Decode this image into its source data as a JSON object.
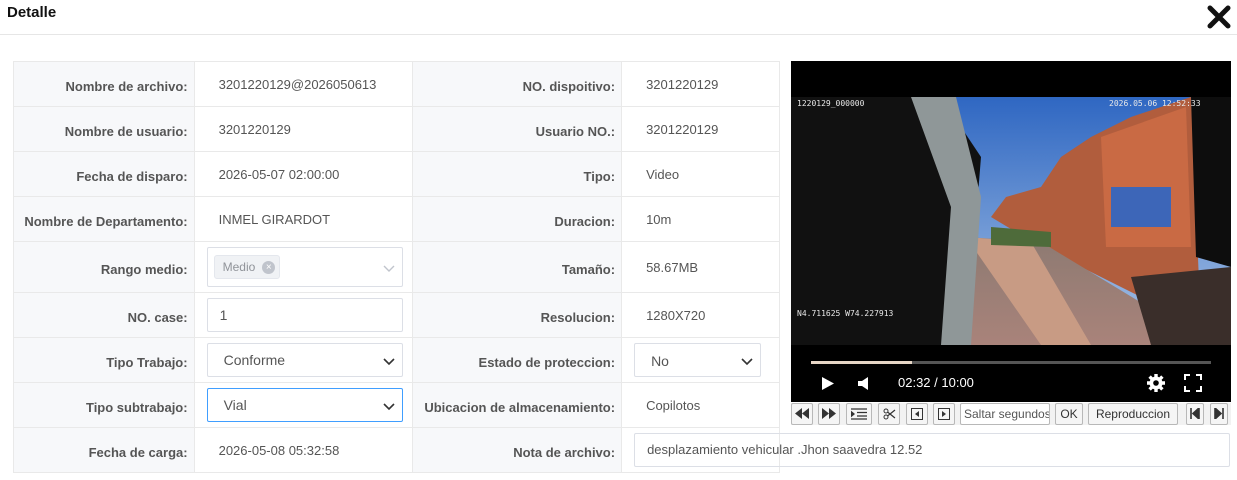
{
  "dialog": {
    "title": "Detalle"
  },
  "left": [
    {
      "label": "Nombre de archivo:",
      "value": "3201220129@2026050613"
    },
    {
      "label": "Nombre de usuario:",
      "value": "3201220129"
    },
    {
      "label": "Fecha de disparo:",
      "value": "2026-05-07 02:00:00"
    },
    {
      "label": "Nombre de Departamento:",
      "value": "INMEL GIRARDOT"
    },
    {
      "label": "Rango medio:",
      "tag": "Medio"
    },
    {
      "label": "NO. case:",
      "value": "1"
    },
    {
      "label": "Tipo Trabajo:",
      "value": "Conforme"
    },
    {
      "label": "Tipo subtrabajo:",
      "value": "Vial"
    },
    {
      "label": "Fecha de carga:",
      "value": "2026-05-08 05:32:58"
    }
  ],
  "right": [
    {
      "label": "NO. dispoitivo:",
      "value": "3201220129"
    },
    {
      "label": "Usuario NO.:",
      "value": "3201220129"
    },
    {
      "label": "Tipo:",
      "value": "Video"
    },
    {
      "label": "Duracion:",
      "value": "10m"
    },
    {
      "label": "Tamaño:",
      "value": "58.67MB"
    },
    {
      "label": "Resolucion:",
      "value": "1280X720"
    },
    {
      "label": "Estado de proteccion:",
      "value": "No"
    },
    {
      "label": "Ubicacion de almacenamiento:",
      "value": "Copilotos"
    },
    {
      "label": "Nota de archivo:",
      "value": "desplazamiento vehicular .Jhon saavedra 12.52"
    }
  ],
  "player": {
    "osd_top_left": "1220129_000000",
    "osd_top_right": "2026.05.06 12:52:33",
    "osd_bottom_left": "N4.711625 W74.227913",
    "time": "02:32 / 10:00",
    "progress": 0.2533
  },
  "toolbar": {
    "seek_placeholder": "Saltar segundos",
    "ok_label": "OK",
    "playback_label": "Reproduccion"
  }
}
